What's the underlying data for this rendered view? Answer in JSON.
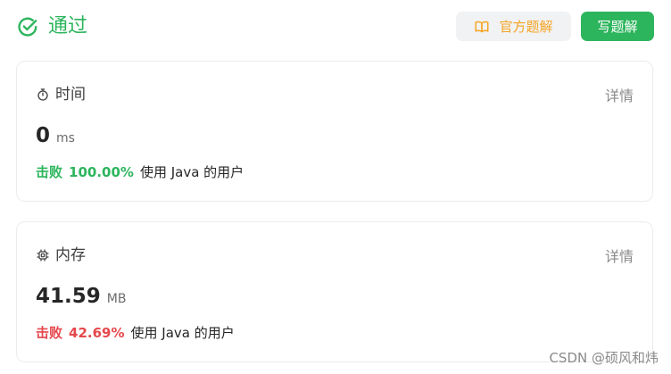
{
  "header": {
    "status_label": "通过",
    "official_solution_label": "官方题解",
    "write_solution_label": "写题解"
  },
  "time_card": {
    "title": "时间",
    "detail_label": "详情",
    "value": "0",
    "unit": "ms",
    "beats_label": "击败",
    "beats_percent": "100.00%",
    "beats_suffix": "使用 Java 的用户"
  },
  "memory_card": {
    "title": "内存",
    "detail_label": "详情",
    "value": "41.59",
    "unit": "MB",
    "beats_label": "击败",
    "beats_percent": "42.69%",
    "beats_suffix": "使用 Java 的用户"
  },
  "watermark": "CSDN @硕风和炜",
  "colors": {
    "accent_green": "#2db55d",
    "accent_orange": "#f5a524",
    "accent_red": "#e5484d"
  },
  "icons": {
    "status": "check-circle-icon",
    "official_solution": "book-icon",
    "time": "stopwatch-icon",
    "memory": "chip-icon"
  }
}
